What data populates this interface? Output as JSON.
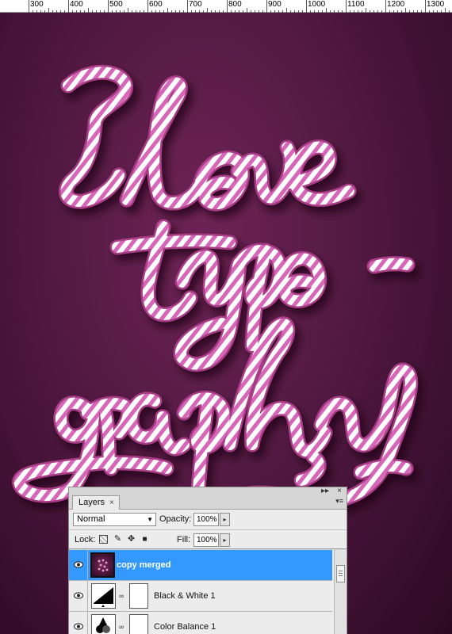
{
  "ruler": {
    "labels": [
      "300",
      "400",
      "500",
      "600",
      "700",
      "800",
      "900",
      "1000",
      "1100",
      "1200",
      "1300"
    ]
  },
  "artwork": {
    "text_lines": [
      "I love",
      "typo-",
      "graphy"
    ],
    "background_color": "#551a44",
    "stripe_colors": [
      "#d766b8",
      "#ffffff"
    ]
  },
  "layers_panel": {
    "tab_label": "Layers",
    "tab_close": "×",
    "panel_buttons": [
      "▸▸",
      "×"
    ],
    "blend_mode": "Normal",
    "opacity_label": "Opacity:",
    "opacity_value": "100%",
    "lock_label": "Lock:",
    "fill_label": "Fill:",
    "fill_value": "100%",
    "layers": [
      {
        "name": "copy merged",
        "selected": true,
        "visible": true,
        "icon": "image-thumbnail"
      },
      {
        "name": "Black & White 1",
        "selected": false,
        "visible": true,
        "icon": "black-white-adjustment-icon"
      },
      {
        "name": "Color Balance 1",
        "selected": false,
        "visible": true,
        "icon": "color-balance-adjustment-icon"
      }
    ],
    "accent_color": "#3399ff"
  }
}
